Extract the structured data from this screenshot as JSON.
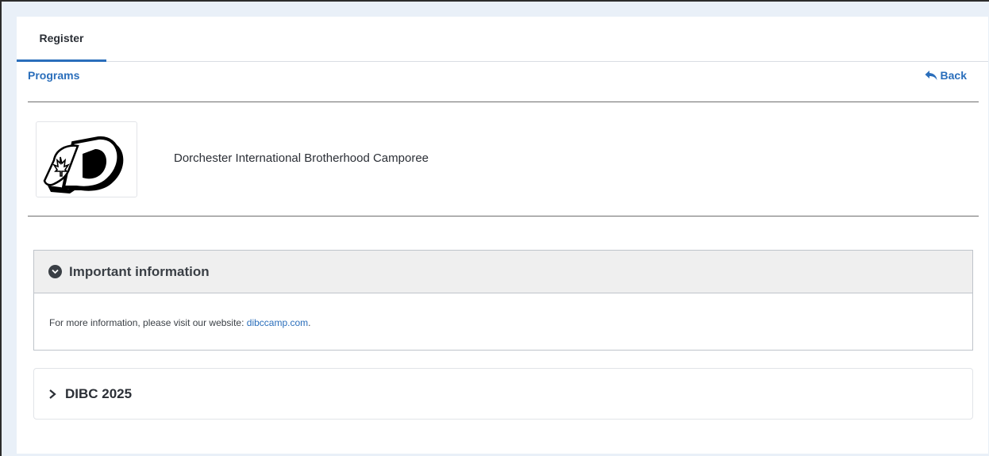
{
  "tabs": [
    {
      "label": "Register"
    }
  ],
  "breadcrumb": {
    "label": "Programs"
  },
  "back": {
    "label": "Back"
  },
  "organization": {
    "name": "Dorchester International Brotherhood Camporee"
  },
  "info": {
    "title": "Important information",
    "text": "For more information, please visit our website: ",
    "link_text": "dibccamp.com",
    "after_link": "."
  },
  "program": {
    "title": "DIBC 2025"
  },
  "icons": {
    "info_toggle": "chevron-down-circle-icon",
    "back": "reply-arrow-icon",
    "program_toggle": "chevron-right-icon"
  },
  "colors": {
    "accent": "#2a6ebb",
    "text": "#2b2f36",
    "header_bg": "#efefef"
  }
}
